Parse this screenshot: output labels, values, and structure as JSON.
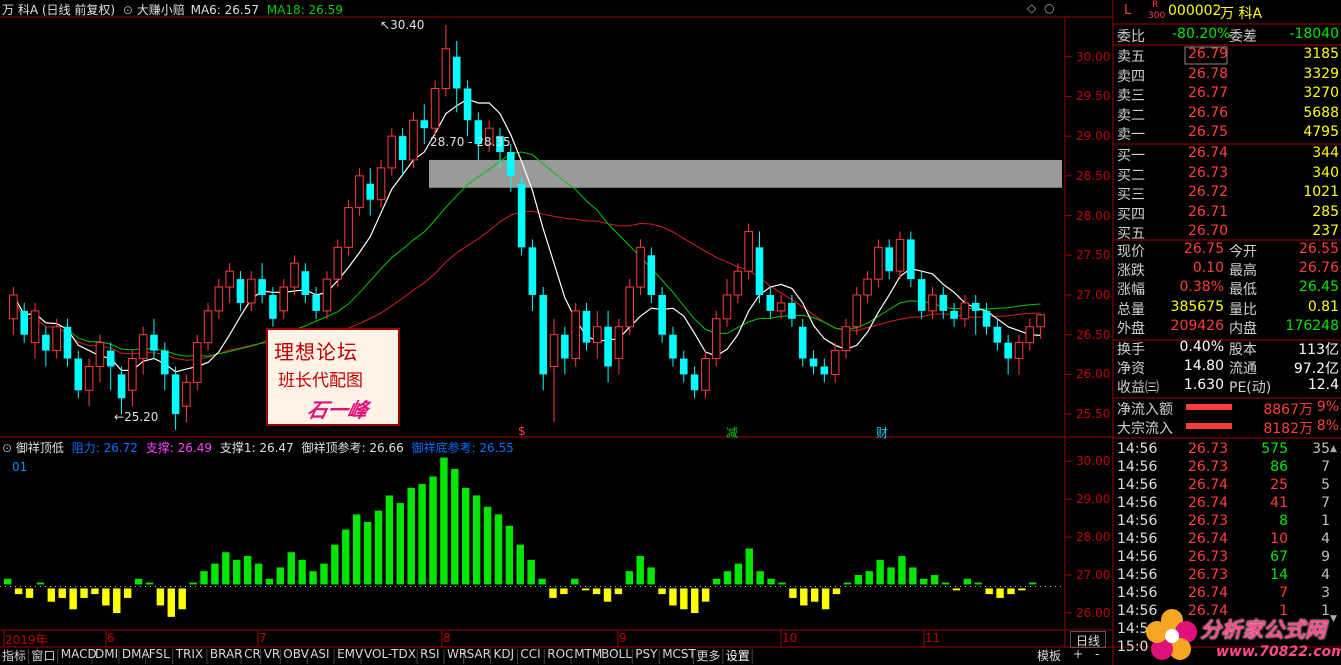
{
  "header": {
    "stock": "万 科A",
    "period": "(日线 前复权)",
    "indicator_name": "大赚小赔",
    "ma6": "MA6: 26.57",
    "ma18": "MA18: 26.59"
  },
  "main_chart": {
    "y_ticks": [
      "30.00",
      "29.50",
      "29.00",
      "28.50",
      "28.00",
      "27.50",
      "27.00",
      "26.50",
      "26.00",
      "25.50"
    ],
    "y_range": [
      25.3,
      30.5
    ],
    "high_label": "30.40",
    "low_label": "25.20",
    "zone_label": "28.70 - 28.35",
    "zone": [
      28.35,
      28.7
    ],
    "event_marks": [
      "$",
      "减",
      "财"
    ],
    "candles": [
      [
        26.7,
        27.0,
        27.1,
        26.5
      ],
      [
        26.8,
        26.5,
        26.9,
        26.4
      ],
      [
        26.4,
        26.8,
        26.9,
        26.2
      ],
      [
        26.5,
        26.3,
        26.6,
        26.1
      ],
      [
        26.3,
        26.6,
        26.7,
        26.2
      ],
      [
        26.6,
        26.2,
        26.7,
        26.1
      ],
      [
        26.2,
        25.8,
        26.3,
        25.7
      ],
      [
        25.8,
        26.1,
        26.2,
        25.6
      ],
      [
        26.1,
        26.4,
        26.5,
        25.9
      ],
      [
        26.3,
        26.1,
        26.4,
        25.8
      ],
      [
        26.0,
        25.7,
        26.1,
        25.5
      ],
      [
        25.8,
        26.2,
        26.3,
        25.6
      ],
      [
        26.2,
        26.5,
        26.6,
        26.0
      ],
      [
        26.5,
        26.3,
        26.7,
        26.2
      ],
      [
        26.3,
        26.0,
        26.4,
        25.8
      ],
      [
        26.0,
        25.5,
        26.1,
        25.3
      ],
      [
        25.6,
        25.9,
        26.0,
        25.4
      ],
      [
        25.9,
        26.4,
        26.5,
        25.8
      ],
      [
        26.4,
        26.8,
        26.9,
        26.3
      ],
      [
        26.8,
        27.1,
        27.2,
        26.7
      ],
      [
        27.1,
        27.3,
        27.4,
        26.9
      ],
      [
        27.2,
        26.9,
        27.3,
        26.8
      ],
      [
        26.9,
        27.2,
        27.3,
        26.8
      ],
      [
        27.2,
        27.0,
        27.4,
        26.9
      ],
      [
        27.0,
        26.7,
        27.1,
        26.6
      ],
      [
        26.8,
        27.1,
        27.2,
        26.7
      ],
      [
        27.1,
        27.4,
        27.5,
        27.0
      ],
      [
        27.3,
        27.0,
        27.4,
        26.9
      ],
      [
        27.0,
        26.8,
        27.1,
        26.7
      ],
      [
        26.8,
        27.2,
        27.3,
        26.7
      ],
      [
        27.2,
        27.6,
        27.7,
        27.1
      ],
      [
        27.6,
        28.1,
        28.2,
        27.5
      ],
      [
        28.1,
        28.5,
        28.6,
        28.0
      ],
      [
        28.4,
        28.2,
        28.6,
        28.0
      ],
      [
        28.2,
        28.6,
        28.7,
        28.1
      ],
      [
        28.6,
        29.0,
        29.1,
        28.5
      ],
      [
        29.0,
        28.7,
        29.1,
        28.5
      ],
      [
        28.7,
        29.2,
        29.3,
        28.6
      ],
      [
        29.2,
        29.1,
        29.4,
        28.9
      ],
      [
        29.1,
        29.6,
        29.7,
        29.0
      ],
      [
        29.6,
        30.1,
        30.4,
        29.5
      ],
      [
        30.0,
        29.6,
        30.2,
        29.3
      ],
      [
        29.6,
        29.2,
        29.7,
        29.0
      ],
      [
        29.2,
        28.9,
        29.3,
        28.7
      ],
      [
        28.9,
        29.1,
        29.2,
        28.8
      ],
      [
        29.0,
        28.8,
        29.1,
        28.6
      ],
      [
        28.8,
        28.5,
        28.9,
        28.3
      ],
      [
        28.4,
        27.6,
        28.5,
        27.5
      ],
      [
        27.6,
        27.0,
        27.7,
        26.8
      ],
      [
        27.0,
        26.0,
        27.1,
        25.8
      ],
      [
        26.1,
        26.5,
        26.7,
        25.4
      ],
      [
        26.5,
        26.2,
        26.6,
        26.0
      ],
      [
        26.2,
        26.8,
        26.9,
        26.1
      ],
      [
        26.8,
        26.4,
        26.9,
        26.3
      ],
      [
        26.4,
        26.6,
        26.8,
        26.2
      ],
      [
        26.6,
        26.1,
        26.8,
        25.9
      ],
      [
        26.2,
        26.6,
        26.7,
        26.0
      ],
      [
        26.6,
        27.1,
        27.2,
        26.5
      ],
      [
        27.1,
        27.6,
        27.7,
        27.0
      ],
      [
        27.5,
        27.0,
        27.6,
        26.9
      ],
      [
        27.0,
        26.5,
        27.1,
        26.4
      ],
      [
        26.5,
        26.2,
        26.6,
        26.1
      ],
      [
        26.2,
        26.0,
        26.3,
        25.9
      ],
      [
        26.0,
        25.8,
        26.1,
        25.7
      ],
      [
        25.8,
        26.2,
        26.3,
        25.7
      ],
      [
        26.2,
        26.7,
        26.8,
        26.1
      ],
      [
        26.7,
        27.0,
        27.2,
        26.6
      ],
      [
        27.0,
        27.3,
        27.4,
        26.9
      ],
      [
        27.3,
        27.8,
        27.9,
        27.2
      ],
      [
        27.6,
        27.0,
        27.8,
        26.9
      ],
      [
        27.0,
        26.8,
        27.1,
        26.7
      ],
      [
        26.8,
        26.9,
        27.0,
        26.7
      ],
      [
        26.9,
        26.7,
        27.0,
        26.6
      ],
      [
        26.6,
        26.2,
        26.7,
        26.1
      ],
      [
        26.2,
        26.1,
        26.3,
        26.0
      ],
      [
        26.1,
        26.0,
        26.2,
        25.9
      ],
      [
        26.0,
        26.3,
        26.4,
        25.9
      ],
      [
        26.3,
        26.6,
        26.7,
        26.2
      ],
      [
        26.6,
        27.0,
        27.1,
        26.5
      ],
      [
        27.0,
        27.2,
        27.3,
        26.9
      ],
      [
        27.2,
        27.6,
        27.7,
        27.1
      ],
      [
        27.6,
        27.3,
        27.7,
        27.2
      ],
      [
        27.3,
        27.7,
        27.8,
        27.2
      ],
      [
        27.7,
        27.2,
        27.8,
        27.1
      ],
      [
        27.2,
        26.8,
        27.3,
        26.7
      ],
      [
        26.8,
        27.0,
        27.1,
        26.7
      ],
      [
        27.0,
        26.8,
        27.1,
        26.7
      ],
      [
        26.8,
        26.7,
        26.9,
        26.6
      ],
      [
        26.7,
        26.9,
        27.0,
        26.6
      ],
      [
        26.9,
        26.8,
        27.0,
        26.5
      ],
      [
        26.8,
        26.6,
        26.9,
        26.5
      ],
      [
        26.6,
        26.4,
        26.7,
        26.3
      ],
      [
        26.4,
        26.2,
        26.5,
        26.0
      ],
      [
        26.2,
        26.4,
        26.5,
        26.0
      ],
      [
        26.4,
        26.6,
        26.7,
        26.3
      ],
      [
        26.6,
        26.75,
        26.76,
        26.45
      ]
    ]
  },
  "sub_chart": {
    "title": "御祥顶低",
    "resistance": "阻力: 26.72",
    "support": "支撑: 26.49",
    "support1": "支撑1: 26.47",
    "top_ref": "御祥顶参考: 26.66",
    "bottom_ref": "御祥底参考: 26.55",
    "id_label": "01",
    "y_ticks": [
      "30.00",
      "29.00",
      "28.00",
      "27.00",
      "26.00"
    ],
    "y_range": [
      25.6,
      30.3
    ],
    "baseline": 26.75,
    "bars": [
      26.9,
      26.6,
      26.5,
      26.8,
      26.4,
      26.5,
      26.2,
      26.5,
      26.6,
      26.3,
      26.1,
      26.5,
      26.9,
      26.8,
      26.3,
      26.0,
      26.2,
      26.8,
      27.1,
      27.3,
      27.6,
      27.4,
      27.5,
      27.3,
      26.9,
      27.2,
      27.6,
      27.4,
      27.1,
      27.3,
      27.8,
      28.2,
      28.6,
      28.4,
      28.7,
      29.1,
      28.9,
      29.3,
      29.4,
      29.6,
      30.1,
      29.8,
      29.3,
      29.1,
      28.8,
      28.6,
      28.3,
      27.8,
      27.4,
      26.9,
      26.5,
      26.6,
      26.9,
      26.7,
      26.6,
      26.4,
      26.6,
      27.1,
      27.5,
      27.2,
      26.6,
      26.3,
      26.2,
      26.1,
      26.4,
      26.9,
      27.1,
      27.3,
      27.7,
      27.1,
      26.9,
      26.8,
      26.5,
      26.3,
      26.4,
      26.2,
      26.6,
      26.8,
      27.0,
      27.1,
      27.4,
      27.2,
      27.5,
      27.2,
      26.9,
      27.0,
      26.8,
      26.7,
      26.9,
      26.8,
      26.6,
      26.5,
      26.6,
      26.7,
      26.8
    ]
  },
  "date_axis": [
    "2019年",
    "6",
    "7",
    "8",
    "9",
    "10",
    "11"
  ],
  "right_panel": {
    "top_icon": "L",
    "sub_icon_top": "R",
    "sub_icon_bottom": "300",
    "code": "000002",
    "name": "万 科A",
    "ratio_label": "委比",
    "ratio_value": "-80.20%",
    "diff_label": "委差",
    "diff_value": "-18040",
    "asks": [
      {
        "label": "卖五",
        "price": "26.79",
        "vol": "3185"
      },
      {
        "label": "卖四",
        "price": "26.78",
        "vol": "3329"
      },
      {
        "label": "卖三",
        "price": "26.77",
        "vol": "3270"
      },
      {
        "label": "卖二",
        "price": "26.76",
        "vol": "5688"
      },
      {
        "label": "卖一",
        "price": "26.75",
        "vol": "4795"
      }
    ],
    "bids": [
      {
        "label": "买一",
        "price": "26.74",
        "vol": "344"
      },
      {
        "label": "买二",
        "price": "26.73",
        "vol": "340"
      },
      {
        "label": "买三",
        "price": "26.72",
        "vol": "1021"
      },
      {
        "label": "买四",
        "price": "26.71",
        "vol": "285"
      },
      {
        "label": "买五",
        "price": "26.70",
        "vol": "237"
      }
    ],
    "stats": [
      {
        "l1": "现价",
        "v1": "26.75",
        "l2": "今开",
        "v2": "26.55"
      },
      {
        "l1": "涨跌",
        "v1": "0.10",
        "l2": "最高",
        "v2": "26.76"
      },
      {
        "l1": "涨幅",
        "v1": "0.38%",
        "l2": "最低",
        "v2": "26.45"
      },
      {
        "l1": "总量",
        "v1": "385675",
        "l2": "量比",
        "v2": "0.81"
      },
      {
        "l1": "外盘",
        "v1": "209426",
        "l2": "内盘",
        "v2": "176248"
      }
    ],
    "stats2": [
      {
        "l1": "换手",
        "v1": "0.40%",
        "l2": "股本",
        "v2": "113亿"
      },
      {
        "l1": "净资",
        "v1": "14.80",
        "l2": "流通",
        "v2": "97.2亿"
      },
      {
        "l1": "收益㈢",
        "v1": "1.630",
        "l2": "PE(动)",
        "v2": "12.4"
      }
    ],
    "flows": [
      {
        "label": "净流入额",
        "value": "8867万",
        "pct": "9%"
      },
      {
        "label": "大宗流入",
        "value": "8182万",
        "pct": "8%"
      }
    ],
    "ticks": [
      {
        "t": "14:56",
        "p": "26.73",
        "v": "575",
        "n": "35"
      },
      {
        "t": "14:56",
        "p": "26.73",
        "v": "86",
        "n": "7"
      },
      {
        "t": "14:56",
        "p": "26.74",
        "v": "25",
        "n": "5"
      },
      {
        "t": "14:56",
        "p": "26.74",
        "v": "41",
        "n": "7"
      },
      {
        "t": "14:56",
        "p": "26.73",
        "v": "8",
        "n": "1"
      },
      {
        "t": "14:56",
        "p": "26.74",
        "v": "10",
        "n": "4"
      },
      {
        "t": "14:56",
        "p": "26.73",
        "v": "67",
        "n": "9"
      },
      {
        "t": "14:56",
        "p": "26.73",
        "v": "14",
        "n": "4"
      },
      {
        "t": "14:56",
        "p": "26.74",
        "v": "7",
        "n": "3"
      },
      {
        "t": "14:56",
        "p": "26.74",
        "v": "1",
        "n": "1"
      },
      {
        "t": "14:5",
        "p": "",
        "v": "",
        "n": ""
      },
      {
        "t": "15:0",
        "p": "",
        "v": "",
        "n": ""
      }
    ],
    "period_button": "日线"
  },
  "watermark": {
    "line1": "理想论坛",
    "line2": "班长代配图",
    "signature": "石一峰",
    "site_cn": "分析家公式网",
    "site_url": "www.70822.com"
  },
  "bottom_bar": [
    "指标",
    "窗口",
    "MACD",
    "DMI",
    "DMA",
    "FSL",
    "TRIX",
    "BRAR",
    "CR",
    "VR",
    "OBV",
    "ASI",
    "EMV",
    "VOL-TDX",
    "RSI",
    "WR",
    "SAR",
    "KDJ",
    "CCI",
    "ROC",
    "MTM",
    "BOLL",
    "PSY",
    "MCST",
    "更多",
    "设置"
  ],
  "template_label": "模板",
  "zoom_in": "+",
  "zoom_out": "-",
  "scroll_up": "▲",
  "scroll_down": "▼",
  "header_up_icon": "◇",
  "header_down_icon": "○",
  "colors": {
    "up": "#ff3c3c",
    "down": "#00ffff",
    "ma6": "#ffffff",
    "ma18": "#00c800",
    "green_bar": "#00e600",
    "yellow_bar": "#ffff00",
    "zone": "#9a9a9a",
    "frame": "#a00000"
  }
}
